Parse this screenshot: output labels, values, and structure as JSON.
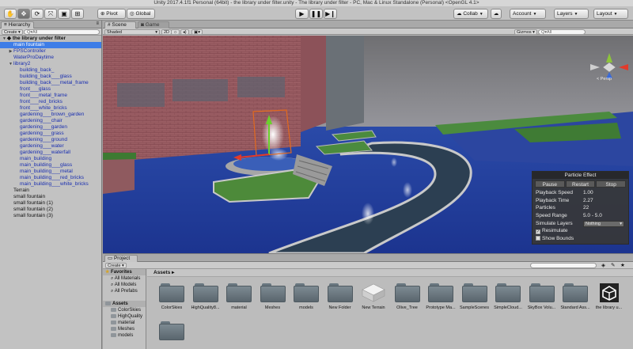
{
  "window": {
    "title": "Unity 2017.4.1f1 Personal (64bit) - the library under filter.unity - The library under filter - PC, Mac & Linux Standalone (Personal) <OpenGL 4.1>"
  },
  "toolbar": {
    "tools": [
      {
        "name": "hand-tool-icon",
        "glyph": "✋"
      },
      {
        "name": "move-tool-icon",
        "glyph": "✥"
      },
      {
        "name": "rotate-tool-icon",
        "glyph": "⟳"
      },
      {
        "name": "scale-tool-icon",
        "glyph": "⤧"
      },
      {
        "name": "rect-tool-icon",
        "glyph": "▣"
      },
      {
        "name": "transform-tool-icon",
        "glyph": "⊞"
      }
    ],
    "pivot_label": "Pivot",
    "global_label": "Global",
    "play_glyphs": [
      "▶",
      "❚❚",
      "▶❙"
    ],
    "collab_label": "Collab",
    "account_label": "Account",
    "layers_label": "Layers",
    "layout_label": "Layout"
  },
  "hierarchy": {
    "tab_label": "Hierarchy",
    "create_label": "Create",
    "search_placeholder": "Q▾All",
    "items": [
      {
        "label": "the library under filter",
        "depth": 0,
        "kind": "scene",
        "arrow": "▼"
      },
      {
        "label": "main fountain",
        "depth": 1,
        "kind": "selected",
        "arrow": ""
      },
      {
        "label": "FPSController",
        "depth": 1,
        "kind": "blue",
        "arrow": "▶"
      },
      {
        "label": "WaterProDaytime",
        "depth": 1,
        "kind": "blue",
        "arrow": ""
      },
      {
        "label": "library2",
        "depth": 1,
        "kind": "blue",
        "arrow": "▼"
      },
      {
        "label": "building_back_",
        "depth": 2,
        "kind": "blue",
        "arrow": ""
      },
      {
        "label": "building_back___glass",
        "depth": 2,
        "kind": "blue",
        "arrow": ""
      },
      {
        "label": "building_back___metal_frame",
        "depth": 2,
        "kind": "blue",
        "arrow": ""
      },
      {
        "label": "front___glass",
        "depth": 2,
        "kind": "blue",
        "arrow": ""
      },
      {
        "label": "front___metal_frame",
        "depth": 2,
        "kind": "blue",
        "arrow": ""
      },
      {
        "label": "front___red_bricks",
        "depth": 2,
        "kind": "blue",
        "arrow": ""
      },
      {
        "label": "front___white_bricks",
        "depth": 2,
        "kind": "blue",
        "arrow": ""
      },
      {
        "label": "gardening___brown_garden",
        "depth": 2,
        "kind": "blue",
        "arrow": ""
      },
      {
        "label": "gardening___chair",
        "depth": 2,
        "kind": "blue",
        "arrow": ""
      },
      {
        "label": "gardening___garden",
        "depth": 2,
        "kind": "blue",
        "arrow": ""
      },
      {
        "label": "gardening___grass",
        "depth": 2,
        "kind": "blue",
        "arrow": ""
      },
      {
        "label": "gardening___ground",
        "depth": 2,
        "kind": "blue",
        "arrow": ""
      },
      {
        "label": "gardening___water",
        "depth": 2,
        "kind": "blue",
        "arrow": ""
      },
      {
        "label": "gardening___waterfall",
        "depth": 2,
        "kind": "blue",
        "arrow": ""
      },
      {
        "label": "main_building",
        "depth": 2,
        "kind": "blue",
        "arrow": ""
      },
      {
        "label": "main_building___glass",
        "depth": 2,
        "kind": "blue",
        "arrow": ""
      },
      {
        "label": "main_building___metal",
        "depth": 2,
        "kind": "blue",
        "arrow": ""
      },
      {
        "label": "main_building___red_bricks",
        "depth": 2,
        "kind": "blue",
        "arrow": ""
      },
      {
        "label": "main_building___white_bricks",
        "depth": 2,
        "kind": "blue",
        "arrow": ""
      },
      {
        "label": "Terrain",
        "depth": 1,
        "kind": "normal",
        "arrow": ""
      },
      {
        "label": "small fountain",
        "depth": 1,
        "kind": "normal",
        "arrow": ""
      },
      {
        "label": "small fountain (1)",
        "depth": 1,
        "kind": "normal",
        "arrow": ""
      },
      {
        "label": "small fountain (2)",
        "depth": 1,
        "kind": "normal",
        "arrow": ""
      },
      {
        "label": "small fountain (3)",
        "depth": 1,
        "kind": "normal",
        "arrow": ""
      }
    ]
  },
  "scene": {
    "tabs": [
      "Scene",
      "Game"
    ],
    "shading_label": "Shaded",
    "mode_2d_label": "2D",
    "gizmos_label": "Gizmos",
    "search_placeholder": "Q▾All",
    "persp_label": "< Persp"
  },
  "particle_effect": {
    "title": "Particle Effect",
    "buttons": [
      "Pause",
      "Restart",
      "Stop"
    ],
    "rows": [
      {
        "label": "Playback Speed",
        "value": "1.00"
      },
      {
        "label": "Playback Time",
        "value": "2.27"
      },
      {
        "label": "Particles",
        "value": "22"
      },
      {
        "label": "Speed Range",
        "value": "5.0 - 5.0"
      }
    ],
    "simulate_layers_label": "Simulate Layers",
    "simulate_layers_value": "Nothing",
    "resimulate_label": "Resimulate",
    "resimulate_checked": true,
    "show_bounds_label": "Show Bounds",
    "show_bounds_checked": false
  },
  "project": {
    "tab_label": "Project",
    "create_label": "Create",
    "tree": [
      {
        "label": "Favorites",
        "kind": "head",
        "icon": "star"
      },
      {
        "label": "All Materials",
        "kind": "fav",
        "icon": "search"
      },
      {
        "label": "All Models",
        "kind": "fav",
        "icon": "search"
      },
      {
        "label": "All Prefabs",
        "kind": "fav",
        "icon": "search"
      },
      {
        "label": "",
        "kind": "spacer",
        "icon": ""
      },
      {
        "label": "Assets",
        "kind": "head",
        "icon": "folder"
      },
      {
        "label": "ColorSkies",
        "kind": "folder",
        "icon": "folder"
      },
      {
        "label": "HighQuality",
        "kind": "folder",
        "icon": "folder"
      },
      {
        "label": "material",
        "kind": "folder",
        "icon": "folder"
      },
      {
        "label": "Meshes",
        "kind": "folder",
        "icon": "folder"
      },
      {
        "label": "models",
        "kind": "folder",
        "icon": "folder"
      }
    ],
    "breadcrumb": "Assets ▸",
    "assets": [
      {
        "label": "ColorSkies",
        "type": "folder"
      },
      {
        "label": "HighQuality8...",
        "type": "folder"
      },
      {
        "label": "material",
        "type": "folder"
      },
      {
        "label": "Meshes",
        "type": "folder"
      },
      {
        "label": "models",
        "type": "folder"
      },
      {
        "label": "New Folder",
        "type": "folder"
      },
      {
        "label": "New Terrain",
        "type": "terrain"
      },
      {
        "label": "Olive_Tree",
        "type": "folder"
      },
      {
        "label": "Prototype Ma...",
        "type": "folder"
      },
      {
        "label": "SampleScenes",
        "type": "folder"
      },
      {
        "label": "SimpleCloud...",
        "type": "folder"
      },
      {
        "label": "SkyBox Volu...",
        "type": "folder"
      },
      {
        "label": "Standard Ass...",
        "type": "folder"
      },
      {
        "label": "the library u...",
        "type": "unity"
      },
      {
        "label": "",
        "type": "folder"
      }
    ]
  }
}
